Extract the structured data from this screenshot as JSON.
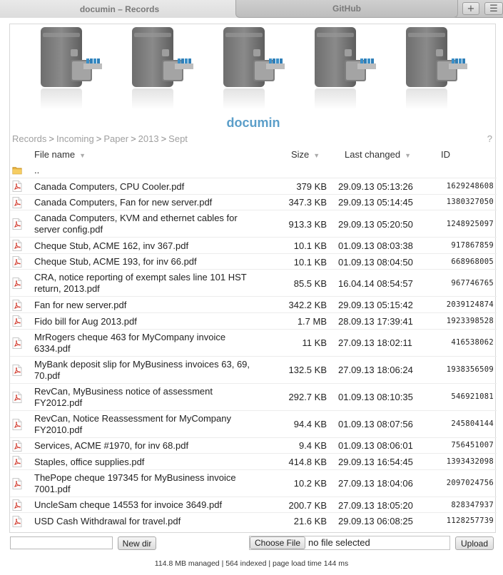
{
  "tabs": {
    "active_title": "documin – Records",
    "other_title": "GitHub",
    "new_tab_glyph": "+",
    "menu_glyph": "☰"
  },
  "header": {
    "logo_text": "documin",
    "cabinet_icon": "file-cabinet-icon"
  },
  "breadcrumb": {
    "items": [
      "Records",
      "Incoming",
      "Paper",
      "2013",
      "Sept"
    ],
    "separator": ">",
    "help": "?"
  },
  "table": {
    "columns": {
      "name": "File name",
      "size": "Size",
      "changed": "Last changed",
      "id": "ID"
    },
    "parent_dir": "..",
    "rows": [
      {
        "name": "Canada Computers, CPU Cooler.pdf",
        "size": "379 KB",
        "changed": "29.09.13 05:13:26",
        "id": "1629248608"
      },
      {
        "name": "Canada Computers, Fan for new server.pdf",
        "size": "347.3 KB",
        "changed": "29.09.13 05:14:45",
        "id": "1380327050"
      },
      {
        "name": "Canada Computers, KVM and ethernet cables for server config.pdf",
        "size": "913.3 KB",
        "changed": "29.09.13 05:20:50",
        "id": "1248925097"
      },
      {
        "name": "Cheque Stub, ACME 162, inv 367.pdf",
        "size": "10.1 KB",
        "changed": "01.09.13 08:03:38",
        "id": "917867859"
      },
      {
        "name": "Cheque Stub, ACME 193, for inv 66.pdf",
        "size": "10.1 KB",
        "changed": "01.09.13 08:04:50",
        "id": "668968005"
      },
      {
        "name": "CRA, notice reporting of exempt sales line 101 HST return, 2013.pdf",
        "size": "85.5 KB",
        "changed": "16.04.14 08:54:57",
        "id": "967746765"
      },
      {
        "name": "Fan for new server.pdf",
        "size": "342.2 KB",
        "changed": "29.09.13 05:15:42",
        "id": "2039124874"
      },
      {
        "name": "Fido bill for Aug 2013.pdf",
        "size": "1.7 MB",
        "changed": "28.09.13 17:39:41",
        "id": "1923398528"
      },
      {
        "name": "MrRogers cheque 463 for MyCompany invoice 6334.pdf",
        "size": "11 KB",
        "changed": "27.09.13 18:02:11",
        "id": "416538062"
      },
      {
        "name": "MyBank deposit slip for MyBusiness invoices 63, 69, 70.pdf",
        "size": "132.5 KB",
        "changed": "27.09.13 18:06:24",
        "id": "1938356509"
      },
      {
        "name": "RevCan, MyBusiness notice of assessment FY2012.pdf",
        "size": "292.7 KB",
        "changed": "01.09.13 08:10:35",
        "id": "546921081"
      },
      {
        "name": "RevCan, Notice Reassessment for MyCompany FY2010.pdf",
        "size": "94.4 KB",
        "changed": "01.09.13 08:07:56",
        "id": "245804144"
      },
      {
        "name": "Services, ACME #1970, for inv 68.pdf",
        "size": "9.4 KB",
        "changed": "01.09.13 08:06:01",
        "id": "756451007"
      },
      {
        "name": "Staples, office supplies.pdf",
        "size": "414.8 KB",
        "changed": "29.09.13 16:54:45",
        "id": "1393432098"
      },
      {
        "name": "ThePope cheque 197345 for MyBusiness invoice 7001.pdf",
        "size": "10.2 KB",
        "changed": "27.09.13 18:04:06",
        "id": "2097024756"
      },
      {
        "name": "UncleSam cheque 14553 for invoice 3649.pdf",
        "size": "200.7 KB",
        "changed": "27.09.13 18:05:20",
        "id": "828347937"
      },
      {
        "name": "USD Cash Withdrawal for travel.pdf",
        "size": "21.6 KB",
        "changed": "29.09.13 06:08:25",
        "id": "1128257739"
      }
    ]
  },
  "controls": {
    "new_dir_value": "",
    "new_dir_label": "New dir",
    "choose_file_label": "Choose File",
    "no_file_text": "no file selected",
    "upload_label": "Upload"
  },
  "footer": {
    "status": "114.8 MB managed | 564 indexed | page load time 144 ms"
  },
  "colors": {
    "logo": "#5b9ec9",
    "pdf_icon": "#d23b2e",
    "folder_icon": "#e9b23e"
  }
}
